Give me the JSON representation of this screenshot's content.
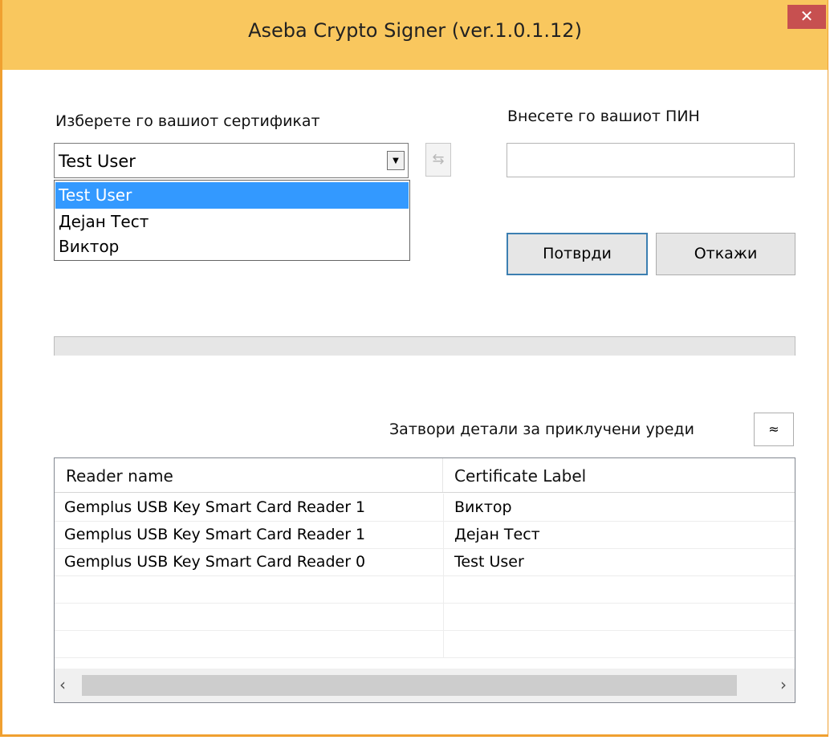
{
  "window": {
    "title": "Aseba Crypto Signer (ver.1.0.1.12)",
    "close_glyph": "✕"
  },
  "certificate": {
    "label": "Изберете го вашиот сертификат",
    "selected": "Test User",
    "options": [
      "Test User",
      "Дејан Тест",
      "Виктор"
    ],
    "selected_index": 0
  },
  "pin": {
    "label": "Внесете го вашиот ПИН",
    "value": ""
  },
  "buttons": {
    "confirm": "Потврди",
    "cancel": "Откажи"
  },
  "devices": {
    "toggle_label": "Затвори детали за приклучени уреди",
    "columns": [
      "Reader name",
      "Certificate Label"
    ],
    "rows": [
      [
        "Gemplus USB Key Smart Card Reader 1",
        "Виктор"
      ],
      [
        "Gemplus USB Key Smart Card Reader 1",
        "Дејан Тест"
      ],
      [
        "Gemplus USB Key Smart Card Reader 0",
        "Test User"
      ],
      [
        "",
        ""
      ],
      [
        "",
        ""
      ],
      [
        "",
        ""
      ]
    ]
  },
  "icons": {
    "dropdown_arrow": "▼",
    "refresh": "⇆",
    "collapse": "≈",
    "scroll_left": "‹",
    "scroll_right": "›"
  },
  "colors": {
    "titlebar": "#f9c75e",
    "close": "#c75050",
    "selection": "#3399ff"
  }
}
